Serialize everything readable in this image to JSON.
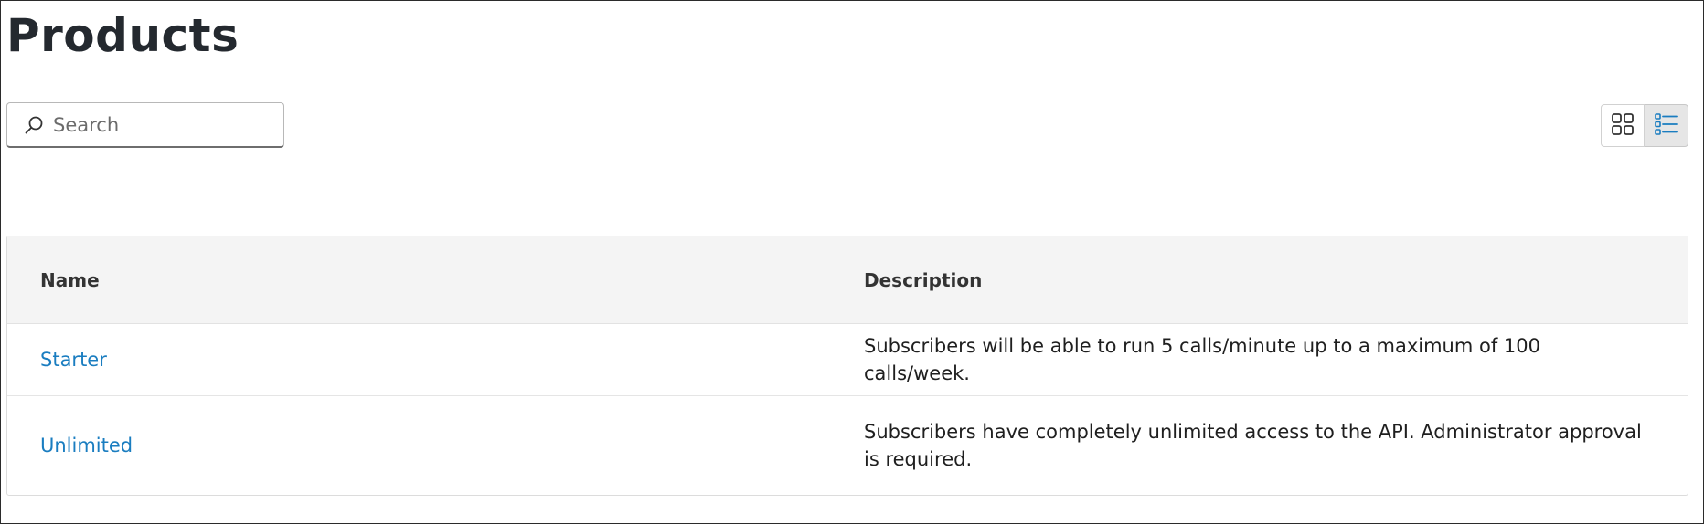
{
  "page": {
    "title": "Products"
  },
  "search": {
    "placeholder": "Search",
    "value": ""
  },
  "view_toggle": {
    "grid_icon": "grid-view-icon",
    "list_icon": "list-view-icon",
    "active": "list"
  },
  "table": {
    "headers": {
      "name": "Name",
      "description": "Description"
    },
    "rows": [
      {
        "name": "Starter",
        "description": "Subscribers will be able to run 5 calls/minute up to a maximum of 100 calls/week."
      },
      {
        "name": "Unlimited",
        "description": "Subscribers have completely unlimited access to the API. Administrator approval is required."
      }
    ]
  },
  "colors": {
    "link": "#1a7dc0",
    "header_bg": "#f4f4f4",
    "active_toggle_bg": "#e6e6e6",
    "icon_accent": "#1a7dc0"
  }
}
